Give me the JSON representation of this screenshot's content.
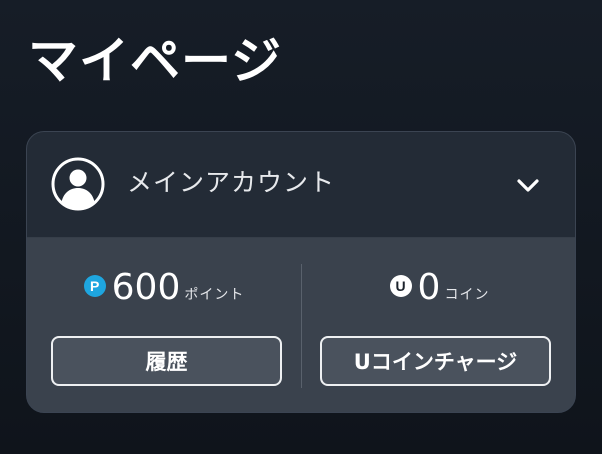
{
  "page": {
    "title": "マイページ"
  },
  "account": {
    "name": "メインアカウント",
    "avatar_icon": "user-circle-icon",
    "toggle_icon": "chevron-down-icon"
  },
  "points": {
    "icon_letter": "P",
    "amount": "600",
    "unit": "ポイント",
    "icon_color": "#1ea6e0"
  },
  "coins": {
    "icon_letter": "U",
    "amount": "0",
    "unit": "コイン"
  },
  "buttons": {
    "history_label": "履歴",
    "charge_label": "Uコインチャージ"
  },
  "colors": {
    "background": "#131a22",
    "card_header": "#232b36",
    "card_body": "#3a424d",
    "button_fill": "#4a525d",
    "button_border": "#eef0f2"
  }
}
